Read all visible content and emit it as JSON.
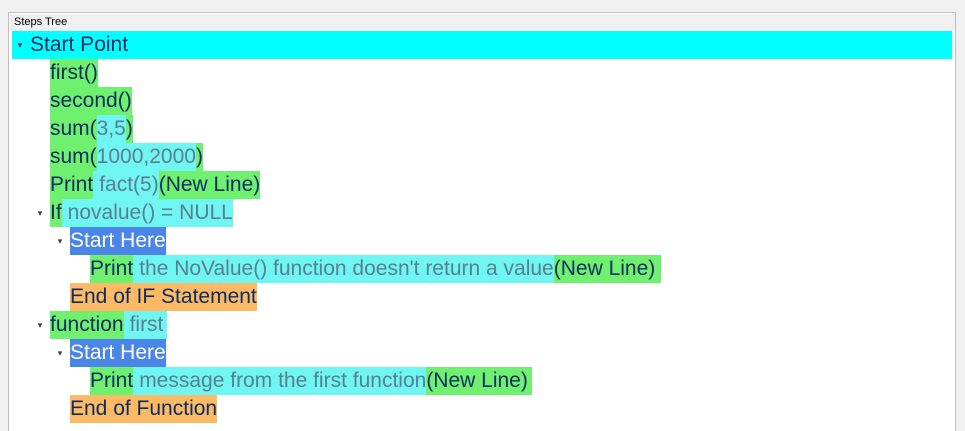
{
  "panel": {
    "title": "Steps Tree"
  },
  "colors": {
    "root_highlight": "#00ffff",
    "keyword_green": "#6ff16f",
    "value_cyan": "#6ff5f2",
    "start_blue": "#4a86e8",
    "end_orange": "#fdb963",
    "text_dark": "#0a2e63",
    "value_text": "#5a7f92"
  },
  "tree": {
    "root": {
      "label": "Start Point",
      "expanded": true,
      "toggle_icon": "collapse-arrow-icon"
    },
    "steps": [
      {
        "id": "first_call",
        "k1": "first()"
      },
      {
        "id": "second_call",
        "k1": "second()"
      },
      {
        "id": "sum_small",
        "k1": "sum(",
        "v1": "3,5",
        "k2": ")"
      },
      {
        "id": "sum_large",
        "k1": "sum(",
        "v1": "1000,2000",
        "k2": ")"
      },
      {
        "id": "print_fact",
        "k1": "Print",
        "v1": "fact(5)",
        "k2": " (New Line)"
      },
      {
        "id": "if_novalue",
        "k1": "If",
        "v1": "novalue() = NULL"
      },
      {
        "id": "if_start",
        "label": "Start Here"
      },
      {
        "id": "print_novalue",
        "k1": "Print",
        "v1": "the NoValue() function doesn't return a value",
        "k2": " (New Line)"
      },
      {
        "id": "if_end",
        "label": "End of IF Statement"
      },
      {
        "id": "function_first",
        "k1": "function",
        "v1": "first"
      },
      {
        "id": "function_start",
        "label": "Start Here"
      },
      {
        "id": "print_message",
        "k1": "Print",
        "v1": "message from the first function",
        "k2": " (New Line)"
      },
      {
        "id": "function_end",
        "label": "End of Function"
      }
    ]
  }
}
